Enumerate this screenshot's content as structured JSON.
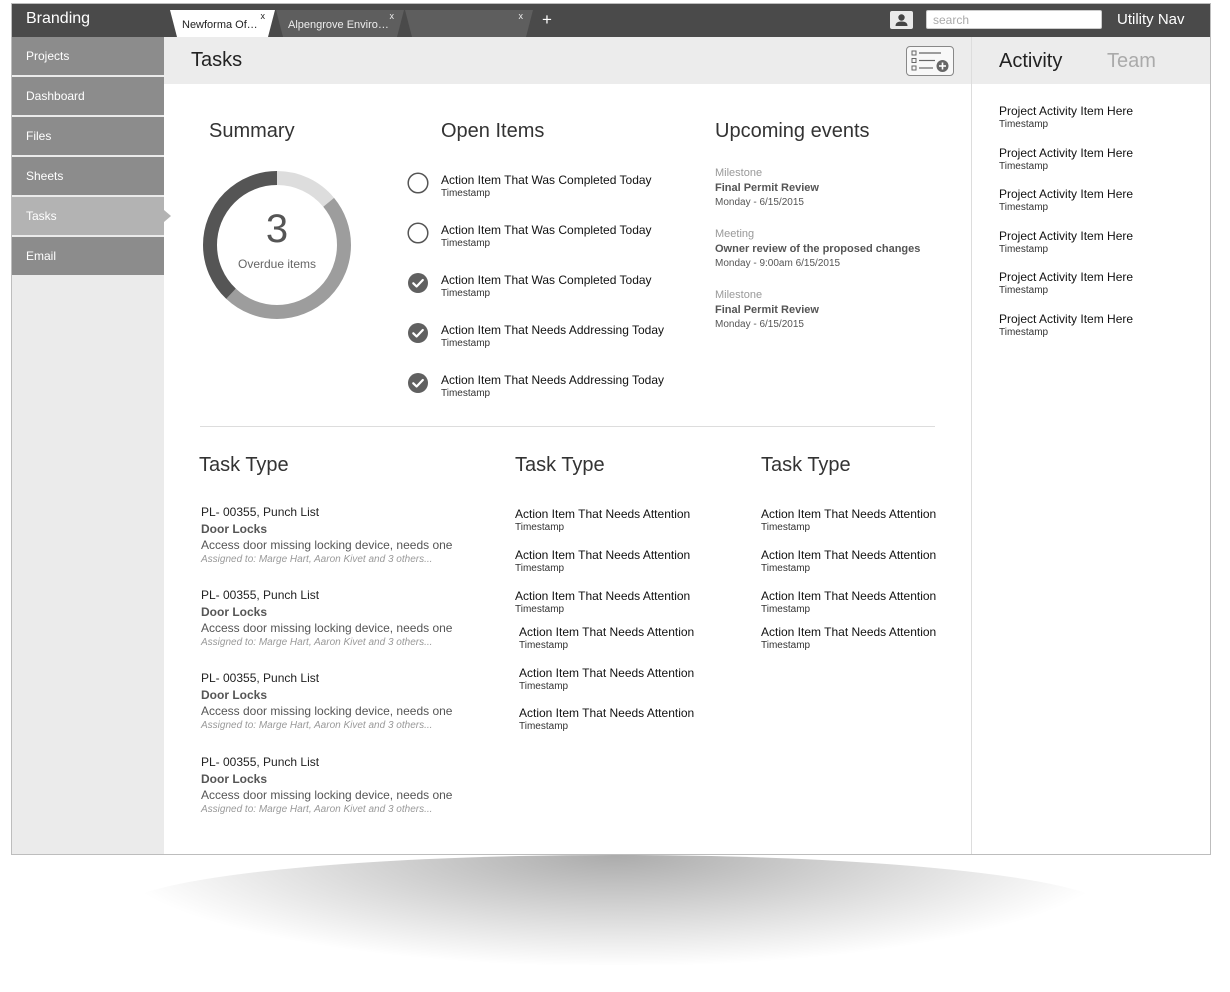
{
  "app": {
    "branding": "Branding",
    "utility_nav": "Utility Nav"
  },
  "tabs": [
    {
      "label": "Newforma Office",
      "close": "x",
      "active": true
    },
    {
      "label": "Alpengrove Environme…",
      "close": "x",
      "active": false
    },
    {
      "label": "",
      "close": "x",
      "active": false
    }
  ],
  "new_tab_label": "+",
  "search": {
    "placeholder": "search",
    "value": ""
  },
  "sidebar": {
    "items": [
      {
        "label": "Projects"
      },
      {
        "label": "Dashboard"
      },
      {
        "label": "Files"
      },
      {
        "label": "Sheets"
      },
      {
        "label": "Tasks",
        "active": true
      },
      {
        "label": "Email"
      }
    ]
  },
  "main": {
    "title": "Tasks",
    "summary": {
      "title": "Summary",
      "count": "3",
      "label": "Overdue items",
      "ring": {
        "dark": 0.38,
        "mid": 0.48,
        "light": 0.14
      }
    },
    "open_items": {
      "title": "Open Items",
      "items": [
        {
          "title": "Action Item That Was Completed Today",
          "sub": "Timestamp",
          "done": false
        },
        {
          "title": "Action Item That Was Completed Today",
          "sub": "Timestamp",
          "done": false
        },
        {
          "title": "Action Item That Was Completed Today",
          "sub": "Timestamp",
          "done": true
        },
        {
          "title": "Action Item That Needs Addressing Today",
          "sub": "Timestamp",
          "done": true
        },
        {
          "title": "Action Item That Needs Addressing Today",
          "sub": "Timestamp",
          "done": true
        }
      ]
    },
    "upcoming": {
      "title": "Upcoming events",
      "events": [
        {
          "type": "Milestone",
          "name": "Final Permit Review",
          "date": "Monday - 6/15/2015"
        },
        {
          "type": "Meeting",
          "name": "Owner review of the proposed changes",
          "date": "Monday - 9:00am  6/15/2015"
        },
        {
          "type": "Milestone",
          "name": "Final Permit Review",
          "date": "Monday - 6/15/2015"
        }
      ]
    },
    "task_types": [
      {
        "title": "Task Type",
        "items": [
          {
            "code": "PL- 00355,  Punch List",
            "name": "Door Locks",
            "desc": "Access door missing locking device, needs one",
            "assigned": "Assigned to: Marge Hart, Aaron Kivet and 3 others..."
          },
          {
            "code": "PL- 00355,  Punch List",
            "name": "Door Locks",
            "desc": "Access door missing locking device, needs one",
            "assigned": "Assigned to: Marge Hart, Aaron Kivet and 3 others..."
          },
          {
            "code": "PL- 00355,  Punch List",
            "name": "Door Locks",
            "desc": "Access door missing locking device, needs one",
            "assigned": "Assigned to: Marge Hart, Aaron Kivet and 3 others..."
          },
          {
            "code": "PL- 00355,  Punch List",
            "name": "Door Locks",
            "desc": "Access door missing locking device, needs one",
            "assigned": "Assigned to: Marge Hart, Aaron Kivet and 3 others..."
          }
        ]
      },
      {
        "title": "Task Type",
        "items": [
          {
            "title": "Action Item That Needs Attention",
            "sub": "Timestamp"
          },
          {
            "title": "Action Item That Needs Attention",
            "sub": "Timestamp"
          },
          {
            "title": "Action Item That Needs Attention",
            "sub": "Timestamp"
          },
          {
            "title": "Action Item That Needs Attention",
            "sub": "Timestamp"
          },
          {
            "title": "Action Item That Needs Attention",
            "sub": "Timestamp"
          },
          {
            "title": "Action Item That Needs Attention",
            "sub": "Timestamp"
          }
        ]
      },
      {
        "title": "Task Type",
        "items": [
          {
            "title": "Action Item That Needs Attention",
            "sub": "Timestamp"
          },
          {
            "title": "Action Item That Needs Attention",
            "sub": "Timestamp"
          },
          {
            "title": "Action Item That Needs Attention",
            "sub": "Timestamp"
          },
          {
            "title": "Action Item That Needs Attention",
            "sub": "Timestamp"
          }
        ]
      }
    ]
  },
  "right_panel": {
    "tabs": [
      {
        "label": "Activity",
        "active": true
      },
      {
        "label": "Team",
        "active": false
      }
    ],
    "items": [
      {
        "title": "Project Activity Item Here",
        "sub": "Timestamp"
      },
      {
        "title": "Project Activity Item Here",
        "sub": "Timestamp"
      },
      {
        "title": "Project Activity Item Here",
        "sub": "Timestamp"
      },
      {
        "title": "Project Activity Item Here",
        "sub": "Timestamp"
      },
      {
        "title": "Project Activity Item Here",
        "sub": "Timestamp"
      },
      {
        "title": "Project Activity Item Here",
        "sub": "Timestamp"
      }
    ]
  },
  "colors": {
    "topbar": "#4a4a4a",
    "nav_item": "#8c8c8c",
    "nav_active": "#b3b3b3",
    "ring_dark": "#555555",
    "ring_mid": "#9d9d9d",
    "ring_light": "#dddddd"
  },
  "icons": {
    "user": "user-icon",
    "add_task": "add-task-list-icon",
    "pending": "empty-circle-icon",
    "done": "check-circle-icon"
  }
}
